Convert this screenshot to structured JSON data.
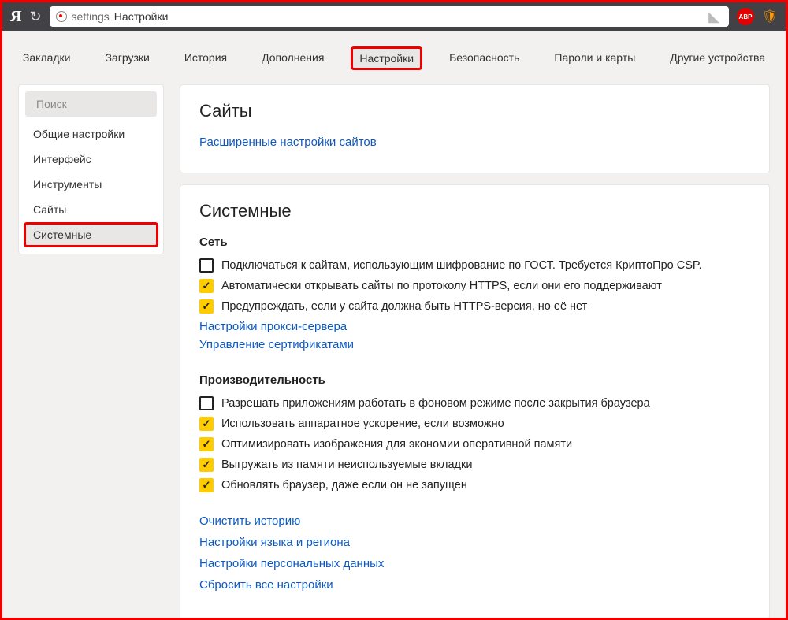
{
  "titlebar": {
    "logo": "Я",
    "addr_prefix": "settings",
    "addr_title": "Настройки",
    "abp": "ABP"
  },
  "tabs": [
    {
      "label": "Закладки",
      "active": false,
      "hl": false
    },
    {
      "label": "Загрузки",
      "active": false,
      "hl": false
    },
    {
      "label": "История",
      "active": false,
      "hl": false
    },
    {
      "label": "Дополнения",
      "active": false,
      "hl": false
    },
    {
      "label": "Настройки",
      "active": true,
      "hl": true
    },
    {
      "label": "Безопасность",
      "active": false,
      "hl": false
    },
    {
      "label": "Пароли и карты",
      "active": false,
      "hl": false
    },
    {
      "label": "Другие устройства",
      "active": false,
      "hl": false
    }
  ],
  "sidebar": {
    "search_placeholder": "Поиск",
    "items": [
      {
        "label": "Общие настройки",
        "selected": false,
        "hl": false
      },
      {
        "label": "Интерфейс",
        "selected": false,
        "hl": false
      },
      {
        "label": "Инструменты",
        "selected": false,
        "hl": false
      },
      {
        "label": "Сайты",
        "selected": false,
        "hl": false
      },
      {
        "label": "Системные",
        "selected": true,
        "hl": true
      }
    ]
  },
  "sites_panel": {
    "title": "Сайты",
    "link": "Расширенные настройки сайтов"
  },
  "system_panel": {
    "title": "Системные",
    "network": {
      "heading": "Сеть",
      "opt1": {
        "checked": false,
        "label": "Подключаться к сайтам, использующим шифрование по ГОСТ. Требуется КриптоПро CSP."
      },
      "opt2": {
        "checked": true,
        "label": "Автоматически открывать сайты по протоколу HTTPS, если они его поддерживают"
      },
      "opt3": {
        "checked": true,
        "label": "Предупреждать, если у сайта должна быть HTTPS-версия, но её нет"
      },
      "link_proxy": "Настройки прокси-сервера",
      "link_cert": "Управление сертификатами"
    },
    "perf": {
      "heading": "Производительность",
      "opt1": {
        "checked": false,
        "label": "Разрешать приложениям работать в фоновом режиме после закрытия браузера"
      },
      "opt2": {
        "checked": true,
        "label": "Использовать аппаратное ускорение, если возможно"
      },
      "opt3": {
        "checked": true,
        "label": "Оптимизировать изображения для экономии оперативной памяти"
      },
      "opt4": {
        "checked": true,
        "label": "Выгружать из памяти неиспользуемые вкладки"
      },
      "opt5": {
        "checked": true,
        "label": "Обновлять браузер, даже если он не запущен"
      }
    },
    "bottom_links": {
      "clear": "Очистить историю",
      "lang": "Настройки языка и региона",
      "personal": "Настройки персональных данных",
      "reset": "Сбросить все настройки"
    }
  }
}
